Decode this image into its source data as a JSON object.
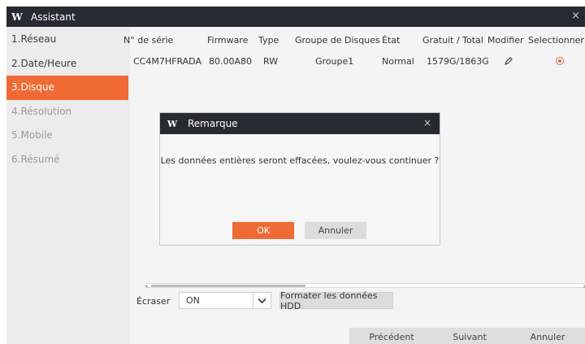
{
  "window": {
    "logo": "W",
    "title": "Assistant",
    "close_glyph": "×"
  },
  "sidebar": {
    "items": [
      {
        "label": "1.Réseau",
        "state": "normal"
      },
      {
        "label": "2.Date/Heure",
        "state": "normal"
      },
      {
        "label": "3.Disque",
        "state": "active"
      },
      {
        "label": "4.Résolution",
        "state": "dim"
      },
      {
        "label": "5.Mobile",
        "state": "dim"
      },
      {
        "label": "6.Résumé",
        "state": "dim"
      }
    ]
  },
  "disk_table": {
    "headers": [
      "N° de série",
      "Firmware",
      "Type",
      "Groupe de Disques",
      "État",
      "Gratuit / Total",
      "Modifier",
      "Selectionner"
    ],
    "rows": [
      {
        "serial": "CC4M7HFRADA",
        "firmware": "80.00A80",
        "type": "RW",
        "group": "Groupe1",
        "state": "Normal",
        "free_total": "1579G/1863G",
        "modify_icon": "pencil-icon",
        "select_icon": "radio-selected-icon"
      }
    ]
  },
  "erase": {
    "label": "Écraser",
    "value": "ON"
  },
  "format_button": "Formater les données HDD",
  "footer": {
    "previous": "Précédent",
    "next": "Suivant",
    "cancel": "Annuler"
  },
  "dialog": {
    "logo": "W",
    "title": "Remarque",
    "close_glyph": "×",
    "message": "Les données entières seront effacées, voulez-vous continuer ?",
    "ok": "OK",
    "cancel": "Annuler"
  },
  "colors": {
    "accent": "#f06a35",
    "titlebar": "#262a31"
  }
}
